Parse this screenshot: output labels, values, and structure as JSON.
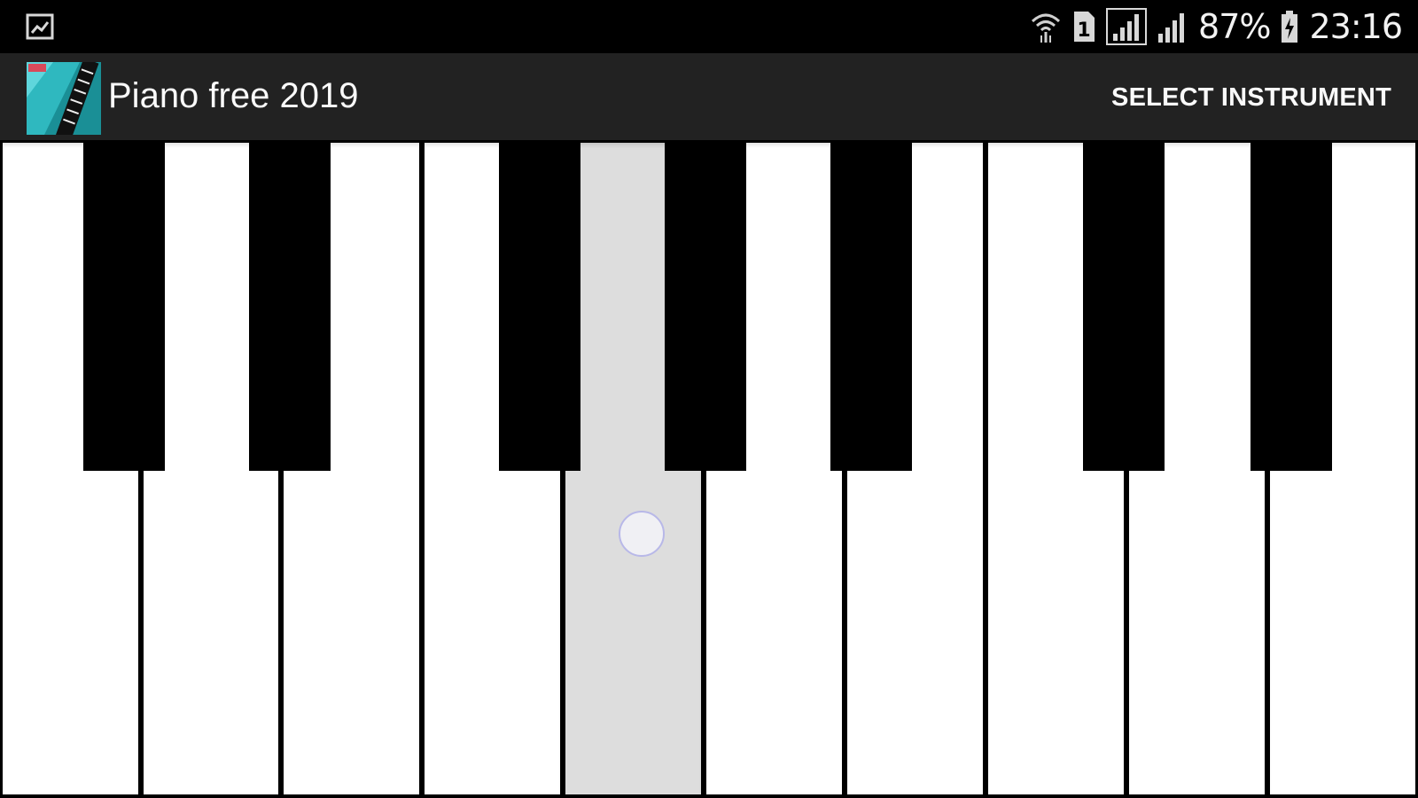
{
  "status_bar": {
    "battery_percent": "87%",
    "time": "23:16",
    "sim_slot": "1",
    "icons": [
      "gallery-notification-icon",
      "wifi-icon",
      "sim-icon",
      "signal-icon",
      "signal-icon",
      "battery-charging-icon"
    ]
  },
  "app_bar": {
    "title": "Piano free 2019",
    "action_label": "SELECT INSTRUMENT",
    "logo_icon": "piano-app-logo"
  },
  "keyboard": {
    "white_key_count": 10,
    "black_key_count": 7,
    "pressed_white_key_index": 4,
    "colors": {
      "white_key": "#ffffff",
      "pressed_key": "#dddddd",
      "black_key": "#000000",
      "app_bar": "#222222"
    }
  }
}
